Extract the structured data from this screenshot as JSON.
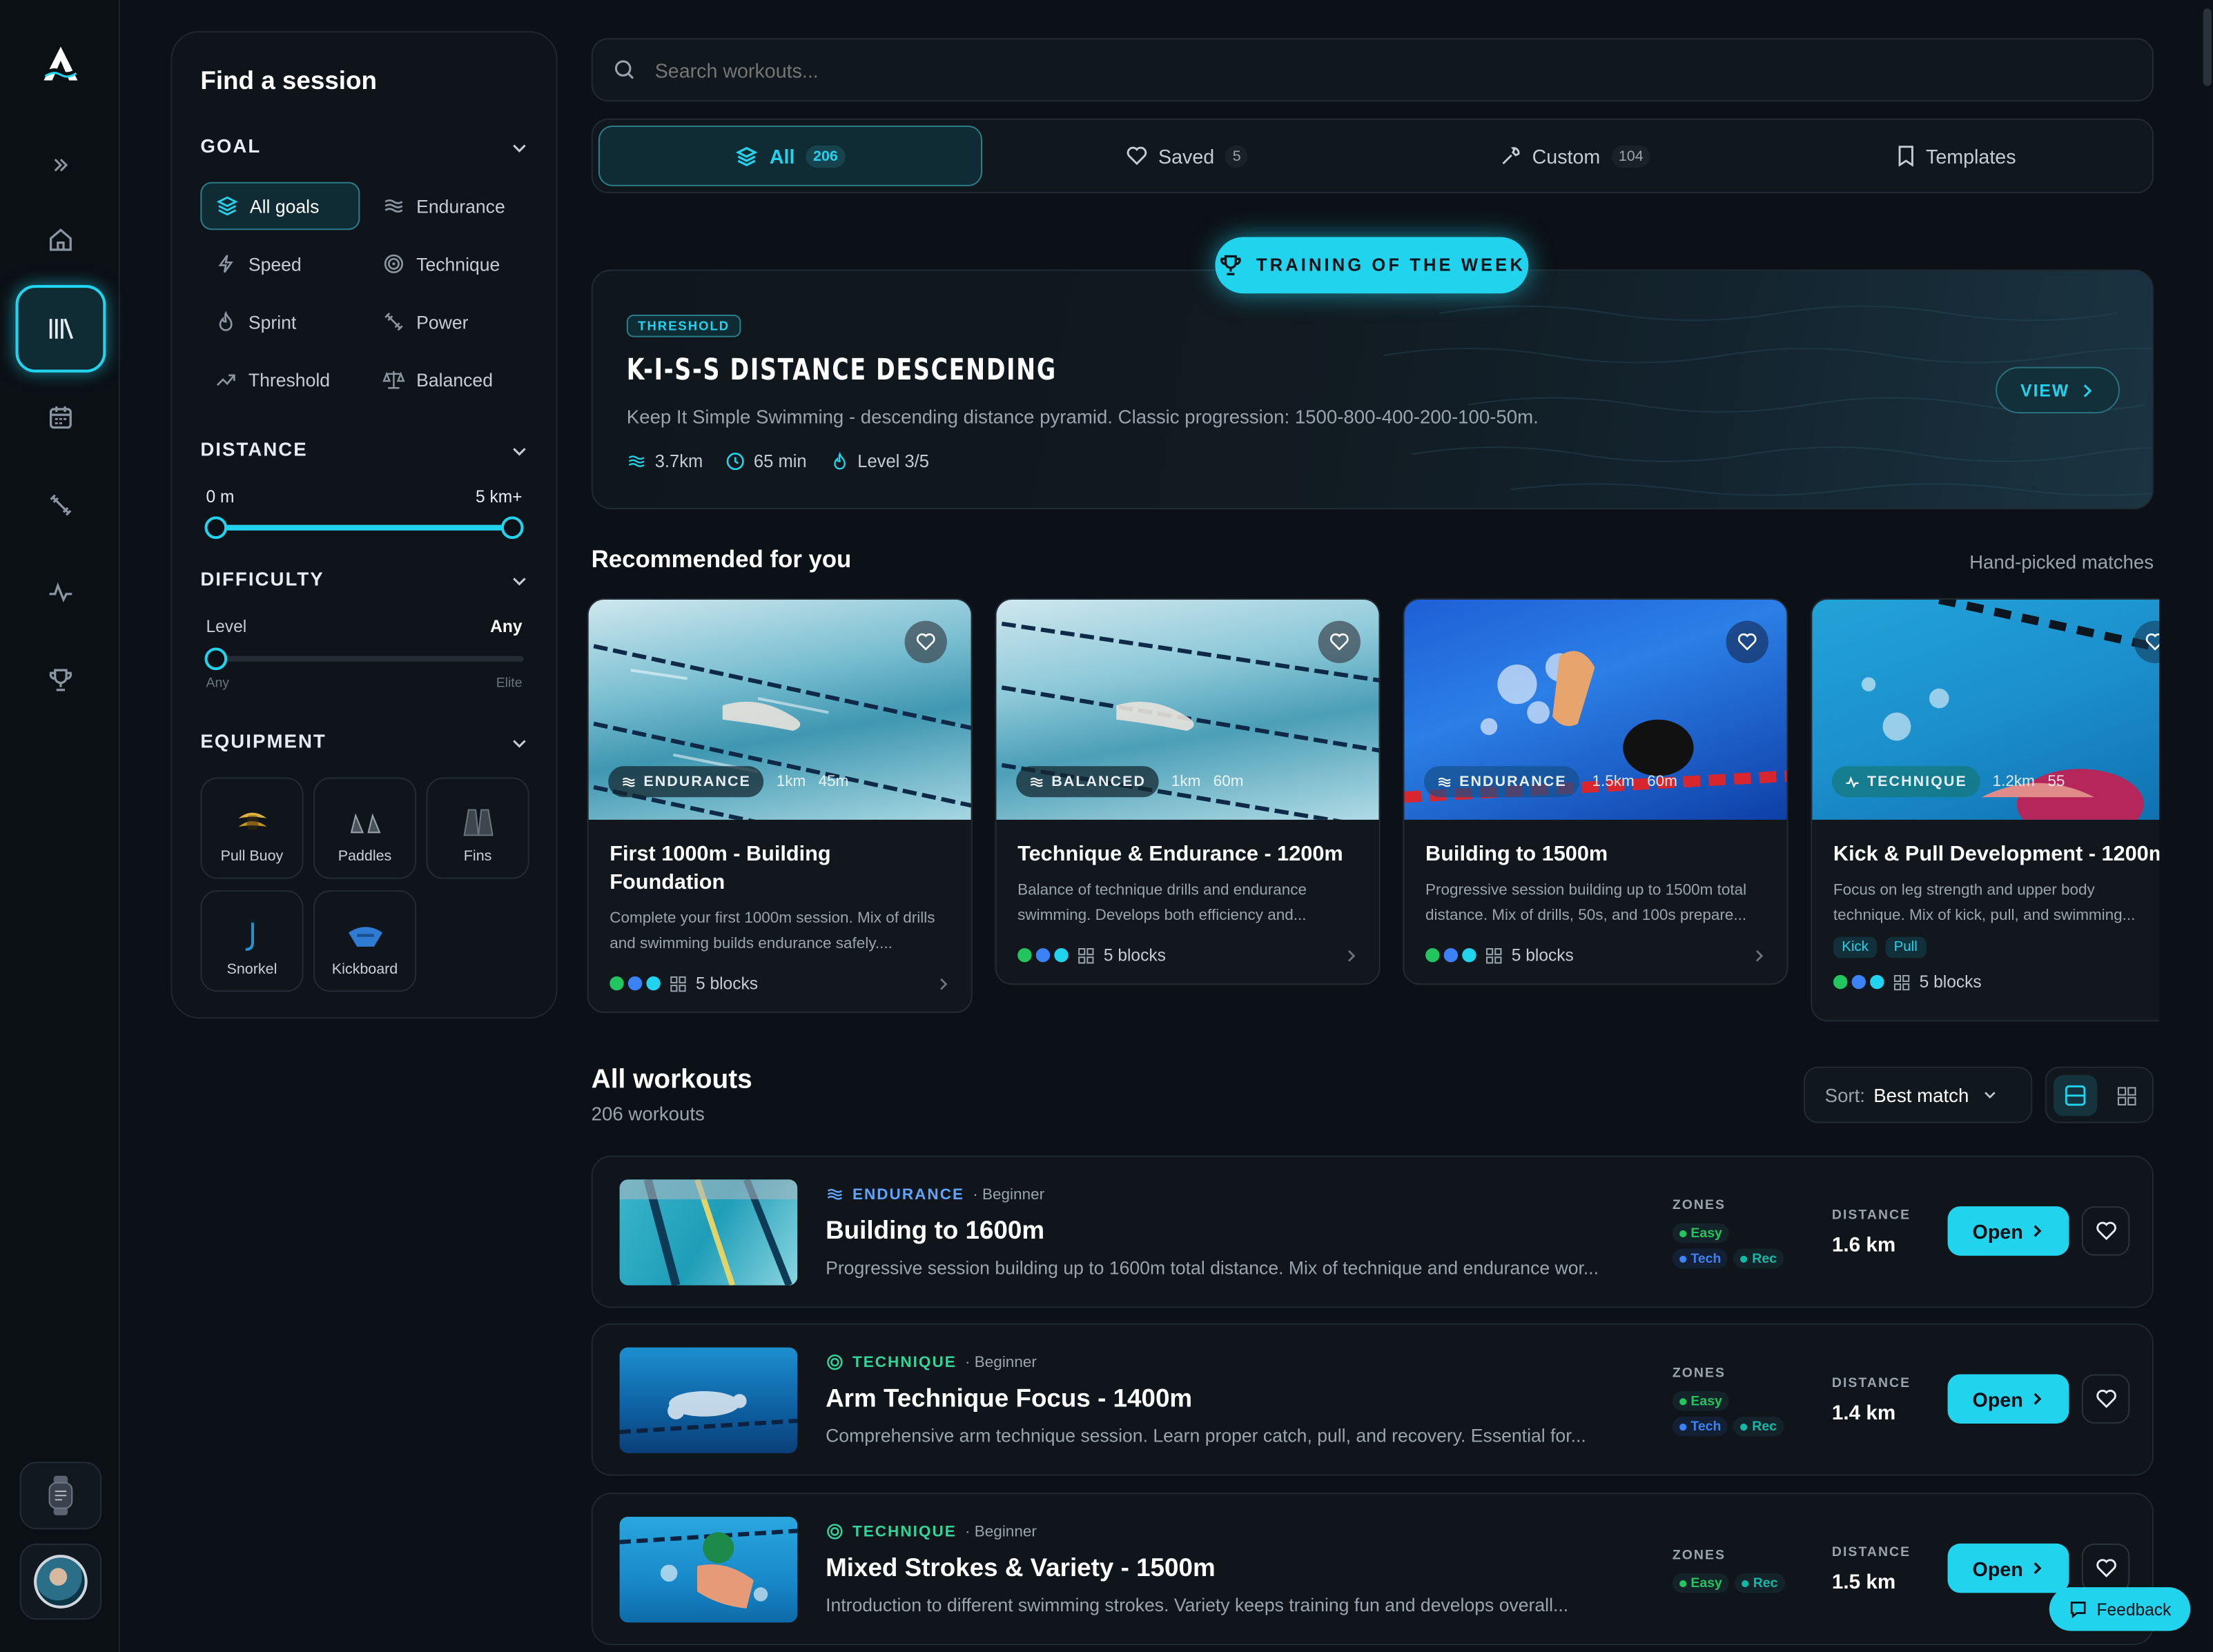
{
  "rail": {
    "logo": "swim-logo",
    "items": [
      "expand-icon",
      "home-icon",
      "library-icon",
      "calendar-icon",
      "tools-icon",
      "activity-icon",
      "trophy-icon"
    ],
    "active": "library-icon",
    "bottom": [
      "watch-icon",
      "user-avatar"
    ]
  },
  "filters": {
    "title": "Find a session",
    "goal": {
      "heading": "GOAL",
      "options": [
        {
          "label": "All goals",
          "icon": "layers-icon",
          "selected": true
        },
        {
          "label": "Endurance",
          "icon": "waves-icon"
        },
        {
          "label": "Speed",
          "icon": "bolt-icon"
        },
        {
          "label": "Technique",
          "icon": "target-icon"
        },
        {
          "label": "Sprint",
          "icon": "flame-icon"
        },
        {
          "label": "Power",
          "icon": "dumbbell-icon"
        },
        {
          "label": "Threshold",
          "icon": "trend-icon"
        },
        {
          "label": "Balanced",
          "icon": "scale-icon"
        }
      ]
    },
    "distance": {
      "heading": "DISTANCE",
      "min_label": "0 m",
      "max_label": "5 km+",
      "low": 0,
      "high": 1
    },
    "difficulty": {
      "heading": "DIFFICULTY",
      "label": "Level",
      "value": "Any",
      "min": "Any",
      "max": "Elite",
      "level": 0
    },
    "equipment": {
      "heading": "EQUIPMENT",
      "items": [
        {
          "label": "Pull Buoy",
          "icon": "pull-buoy-icon"
        },
        {
          "label": "Paddles",
          "icon": "paddles-icon"
        },
        {
          "label": "Fins",
          "icon": "fins-icon"
        },
        {
          "label": "Snorkel",
          "icon": "snorkel-icon"
        },
        {
          "label": "Kickboard",
          "icon": "kickboard-icon"
        }
      ]
    }
  },
  "search": {
    "placeholder": "Search workouts..."
  },
  "tabs": [
    {
      "label": "All",
      "count": "206",
      "icon": "layers-icon",
      "active": true
    },
    {
      "label": "Saved",
      "count": "5",
      "icon": "heart-icon"
    },
    {
      "label": "Custom",
      "count": "104",
      "icon": "wrench-icon"
    },
    {
      "label": "Templates",
      "count": "",
      "icon": "bookmark-icon"
    }
  ],
  "featured": {
    "badge": "TRAINING OF THE WEEK",
    "tag": "THRESHOLD",
    "title": "K-I-S-S DISTANCE DESCENDING",
    "desc": "Keep It Simple Swimming - descending distance pyramid. Classic progression: 1500-800-400-200-100-50m.",
    "distance": "3.7km",
    "duration": "65 min",
    "level": "Level 3/5",
    "view": "VIEW"
  },
  "recommended": {
    "title": "Recommended for you",
    "subtitle": "Hand-picked matches",
    "cards": [
      {
        "tag": "ENDURANCE",
        "dist": "1km",
        "time": "45m",
        "title": "First 1000m - Building Foundation",
        "desc": "Complete your first 1000m session. Mix of drills and swimming builds endurance safely....",
        "blocks": "5 blocks",
        "chips": []
      },
      {
        "tag": "BALANCED",
        "dist": "1km",
        "time": "60m",
        "title": "Technique & Endurance - 1200m",
        "desc": "Balance of technique drills and endurance swimming. Develops both efficiency and...",
        "blocks": "5 blocks",
        "chips": []
      },
      {
        "tag": "ENDURANCE",
        "dist": "1.5km",
        "time": "60m",
        "title": "Building to 1500m",
        "desc": "Progressive session building up to 1500m total distance. Mix of drills, 50s, and 100s prepare...",
        "blocks": "5 blocks",
        "chips": []
      },
      {
        "tag": "TECHNIQUE",
        "dist": "1.2km",
        "time": "55",
        "title": "Kick & Pull Development - 1200m",
        "desc": "Focus on leg strength and upper body technique. Mix of kick, pull, and swimming...",
        "blocks": "5 blocks",
        "chips": [
          "Kick",
          "Pull"
        ]
      }
    ]
  },
  "all": {
    "title": "All workouts",
    "count": "206 workouts",
    "sort_label": "Sort:",
    "sort_value": "Best match",
    "zones_label": "ZONES",
    "distance_label": "DISTANCE",
    "open_label": "Open",
    "rows": [
      {
        "category": "ENDURANCE",
        "level": "· Beginner",
        "title": "Building to 1600m",
        "desc": "Progressive session building up to 1600m total distance. Mix of technique and endurance wor...",
        "distance": "1.6 km",
        "zones": [
          "Easy",
          "Tech",
          "Rec"
        ]
      },
      {
        "category": "TECHNIQUE",
        "level": "· Beginner",
        "title": "Arm Technique Focus - 1400m",
        "desc": "Comprehensive arm technique session. Learn proper catch, pull, and recovery. Essential for...",
        "distance": "1.4 km",
        "zones": [
          "Easy",
          "Tech",
          "Rec"
        ]
      },
      {
        "category": "TECHNIQUE",
        "level": "· Beginner",
        "title": "Mixed Strokes & Variety - 1500m",
        "desc": "Introduction to different swimming strokes. Variety keeps training fun and develops overall...",
        "distance": "1.5 km",
        "zones": [
          "Easy",
          "Rec"
        ]
      }
    ]
  },
  "feedback": {
    "label": "Feedback"
  },
  "colors": {
    "accent": "#22d3ee",
    "bg": "#0c1117",
    "panel": "#0e1419",
    "easy": "#22c55e",
    "tech": "#3b82f6",
    "rec": "#14b8a6",
    "endurance": "#60a5fa",
    "technique": "#34d399"
  }
}
